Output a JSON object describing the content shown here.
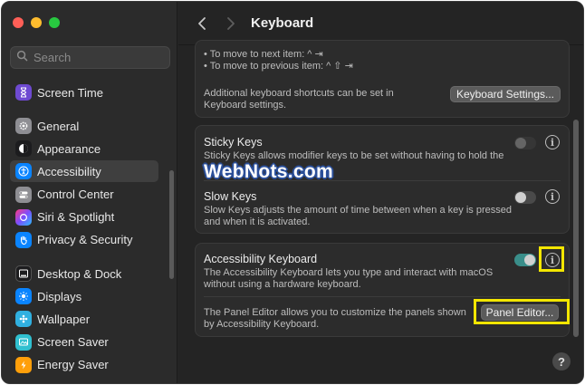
{
  "window": {
    "title": "Keyboard"
  },
  "search": {
    "placeholder": "Search"
  },
  "sidebar": {
    "items_top": [
      {
        "label": "Screen Time",
        "icon": "hourglass-icon",
        "color": "#6e4ad1"
      }
    ],
    "items_mid": [
      {
        "label": "General",
        "icon": "gear-icon",
        "color": "#8e8e93"
      },
      {
        "label": "Appearance",
        "icon": "appearance-icon",
        "color": "#1c1c1e"
      },
      {
        "label": "Accessibility",
        "icon": "accessibility-icon",
        "color": "#0a84ff",
        "active": true
      },
      {
        "label": "Control Center",
        "icon": "control-center-icon",
        "color": "#8e8e93"
      },
      {
        "label": "Siri & Spotlight",
        "icon": "siri-icon",
        "color": "#c14fd8"
      },
      {
        "label": "Privacy & Security",
        "icon": "hand-icon",
        "color": "#0a84ff"
      }
    ],
    "items_bottom": [
      {
        "label": "Desktop & Dock",
        "icon": "dock-icon",
        "color": "#1c1c1e"
      },
      {
        "label": "Displays",
        "icon": "sun-icon",
        "color": "#0a84ff"
      },
      {
        "label": "Wallpaper",
        "icon": "wallpaper-icon",
        "color": "#30b0e0"
      },
      {
        "label": "Screen Saver",
        "icon": "screen-saver-icon",
        "color": "#30c0d0"
      },
      {
        "label": "Energy Saver",
        "icon": "battery-icon",
        "color": "#ff9f0a"
      }
    ]
  },
  "shortcuts": {
    "line1": "• To move to next item: ^ ⇥",
    "line2": "• To move to previous item: ^ ⇧ ⇥",
    "note": "Additional keyboard shortcuts can be set in Keyboard settings.",
    "button": "Keyboard Settings..."
  },
  "sticky_keys": {
    "title": "Sticky Keys",
    "desc": "Sticky Keys allows modifier keys to be set without having to hold the",
    "enabled": false
  },
  "watermark": "WebNots.com",
  "slow_keys": {
    "title": "Slow Keys",
    "desc": "Slow Keys adjusts the amount of time between when a key is pressed and when it is activated.",
    "enabled": false
  },
  "accessibility_keyboard": {
    "title": "Accessibility Keyboard",
    "desc": "The Accessibility Keyboard lets you type and interact with macOS without using a hardware keyboard.",
    "enabled": true,
    "panel_note": "The Panel Editor allows you to customize the panels shown by Accessibility Keyboard.",
    "panel_button": "Panel Editor..."
  },
  "info_glyph": "i",
  "help_glyph": "?",
  "colors": {
    "accent": "#0a84ff",
    "toggle_on": "#3a8e8a",
    "highlight": "#f3e600"
  }
}
